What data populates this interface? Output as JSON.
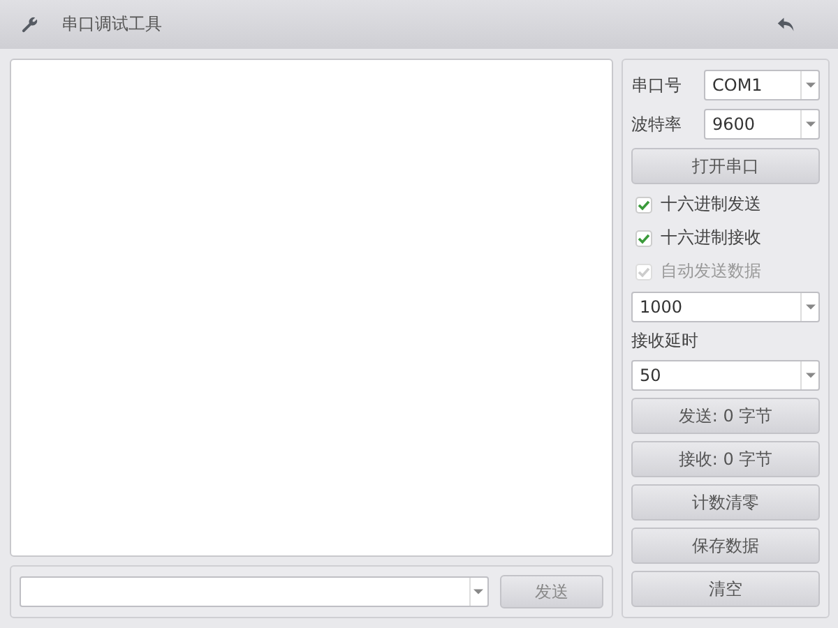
{
  "window": {
    "title": "串口调试工具"
  },
  "settings": [
    {
      "label": "串口号",
      "value": "COM1"
    },
    {
      "label": "波特率",
      "value": "9600"
    }
  ],
  "open_button": "打开串口",
  "options": [
    {
      "label": "十六进制发送",
      "checked": true,
      "disabled": false
    },
    {
      "label": "十六进制接收",
      "checked": true,
      "disabled": false
    },
    {
      "label": "自动发送数据",
      "checked": true,
      "disabled": true
    }
  ],
  "interval": {
    "value": "1000"
  },
  "receive_delay": {
    "label": "接收延时",
    "value": "50"
  },
  "buttons": [
    "发送: 0 字节",
    "接收: 0 字节",
    "计数清零",
    "保存数据",
    "清空"
  ],
  "send_bar": {
    "button": "发送",
    "disabled": true
  }
}
